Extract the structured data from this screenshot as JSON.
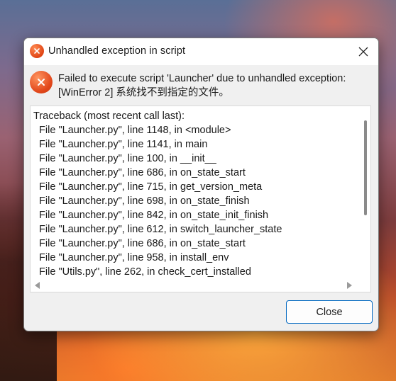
{
  "dialog": {
    "title": "Unhandled exception in script",
    "message": "Failed to execute script 'Launcher' due to unhandled exception: [WinError 2] 系统找不到指定的文件。",
    "traceback_lines": [
      "Traceback (most recent call last):",
      "  File \"Launcher.py\", line 1148, in <module>",
      "  File \"Launcher.py\", line 1141, in main",
      "  File \"Launcher.py\", line 100, in __init__",
      "  File \"Launcher.py\", line 686, in on_state_start",
      "  File \"Launcher.py\", line 715, in get_version_meta",
      "  File \"Launcher.py\", line 698, in on_state_finish",
      "  File \"Launcher.py\", line 842, in on_state_init_finish",
      "  File \"Launcher.py\", line 612, in switch_launcher_state",
      "  File \"Launcher.py\", line 686, in on_state_start",
      "  File \"Launcher.py\", line 958, in install_env",
      "  File \"Utils.py\", line 262, in check_cert_installed"
    ],
    "close_button_label": "Close"
  },
  "icons": {
    "title_icon": "error-icon",
    "message_icon": "error-icon",
    "window_close": "close-icon"
  },
  "colors": {
    "error_accent": "#e1461a",
    "button_border": "#0067c0"
  }
}
